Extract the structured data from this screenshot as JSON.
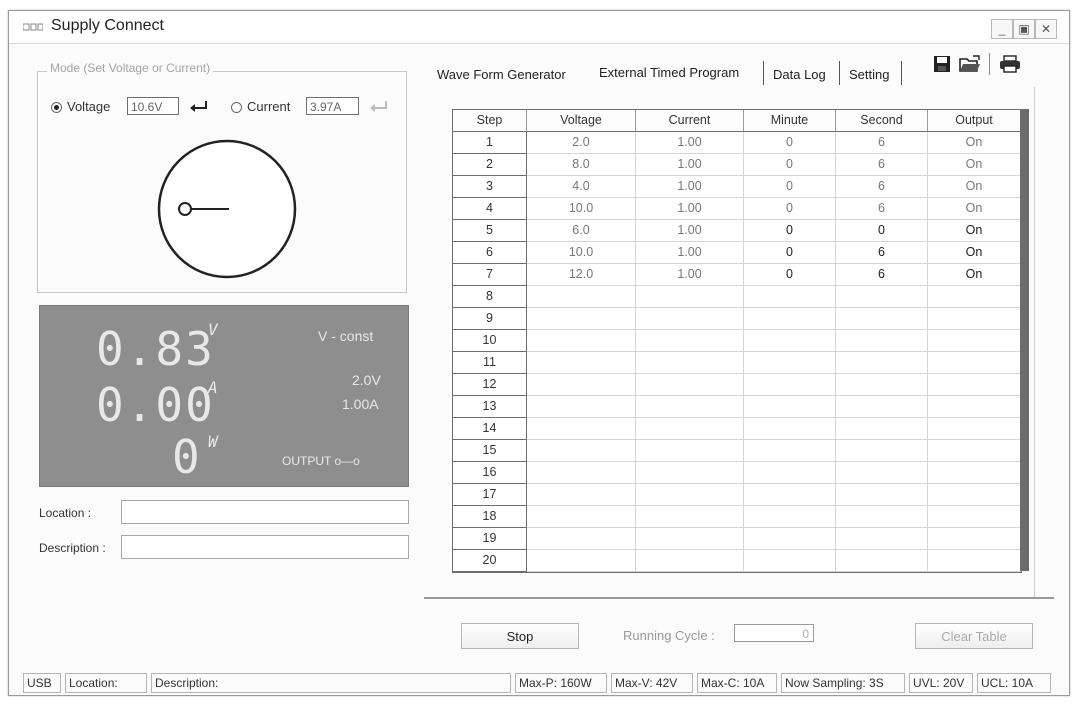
{
  "window": {
    "title": "Supply Connect"
  },
  "mode": {
    "legend": "Mode (Set Voltage or Current)",
    "voltage_label": "Voltage",
    "voltage_value": "10.6V",
    "current_label": "Current",
    "current_value": "3.97A",
    "selected": "Voltage"
  },
  "display": {
    "voltage_reading": "0.83",
    "voltage_unit": "V",
    "current_reading": "0.00",
    "current_unit": "A",
    "power_reading": "0",
    "power_unit": "W",
    "mode_text": "V - const",
    "set_voltage": "2.0V",
    "set_current": "1.00A",
    "output_text": "OUTPUT o—o"
  },
  "fields": {
    "location_label": "Location :",
    "description_label": "Description :"
  },
  "tabs": [
    {
      "label": "Wave Form Generator",
      "active": false
    },
    {
      "label": "External Timed Program",
      "active": true
    },
    {
      "label": "Data Log",
      "active": false
    },
    {
      "label": "Setting",
      "active": false
    }
  ],
  "toolbar_icons": [
    "save-icon",
    "open-folder-icon",
    "print-icon"
  ],
  "table": {
    "headers": [
      "Step",
      "Voltage",
      "Current",
      "Minute",
      "Second",
      "Output"
    ],
    "rows": [
      [
        "1",
        "2.0",
        "1.00",
        "0",
        "6",
        "On"
      ],
      [
        "2",
        "8.0",
        "1.00",
        "0",
        "6",
        "On"
      ],
      [
        "3",
        "4.0",
        "1.00",
        "0",
        "6",
        "On"
      ],
      [
        "4",
        "10.0",
        "1.00",
        "0",
        "6",
        "On"
      ],
      [
        "5",
        "6.0",
        "1.00",
        "0",
        "0",
        "On"
      ],
      [
        "6",
        "10.0",
        "1.00",
        "0",
        "6",
        "On"
      ],
      [
        "7",
        "12.0",
        "1.00",
        "0",
        "6",
        "On"
      ],
      [
        "8",
        "",
        "",
        "",
        "",
        ""
      ],
      [
        "9",
        "",
        "",
        "",
        "",
        ""
      ],
      [
        "10",
        "",
        "",
        "",
        "",
        ""
      ],
      [
        "11",
        "",
        "",
        "",
        "",
        ""
      ],
      [
        "12",
        "",
        "",
        "",
        "",
        ""
      ],
      [
        "13",
        "",
        "",
        "",
        "",
        ""
      ],
      [
        "14",
        "",
        "",
        "",
        "",
        ""
      ],
      [
        "15",
        "",
        "",
        "",
        "",
        ""
      ],
      [
        "16",
        "",
        "",
        "",
        "",
        ""
      ],
      [
        "17",
        "",
        "",
        "",
        "",
        ""
      ],
      [
        "18",
        "",
        "",
        "",
        "",
        ""
      ],
      [
        "19",
        "",
        "",
        "",
        "",
        ""
      ],
      [
        "20",
        "",
        "",
        "",
        "",
        ""
      ]
    ]
  },
  "controls": {
    "stop_label": "Stop",
    "running_cycle_label": "Running Cycle :",
    "running_cycle_value": "0",
    "clear_table_label": "Clear Table"
  },
  "status": {
    "usb": "USB",
    "location": "Location:",
    "description": "Description:",
    "max_p": "Max-P: 160W",
    "max_v": "Max-V: 42V",
    "max_c": "Max-C: 10A",
    "sampling": "Now Sampling: 3S",
    "uvl": "UVL: 20V",
    "ucl": "UCL: 10A"
  },
  "colors": {
    "display_bg": "#8e8e8e",
    "display_text": "#e8e8e8",
    "grid_scroll": "#6c6c6c"
  }
}
